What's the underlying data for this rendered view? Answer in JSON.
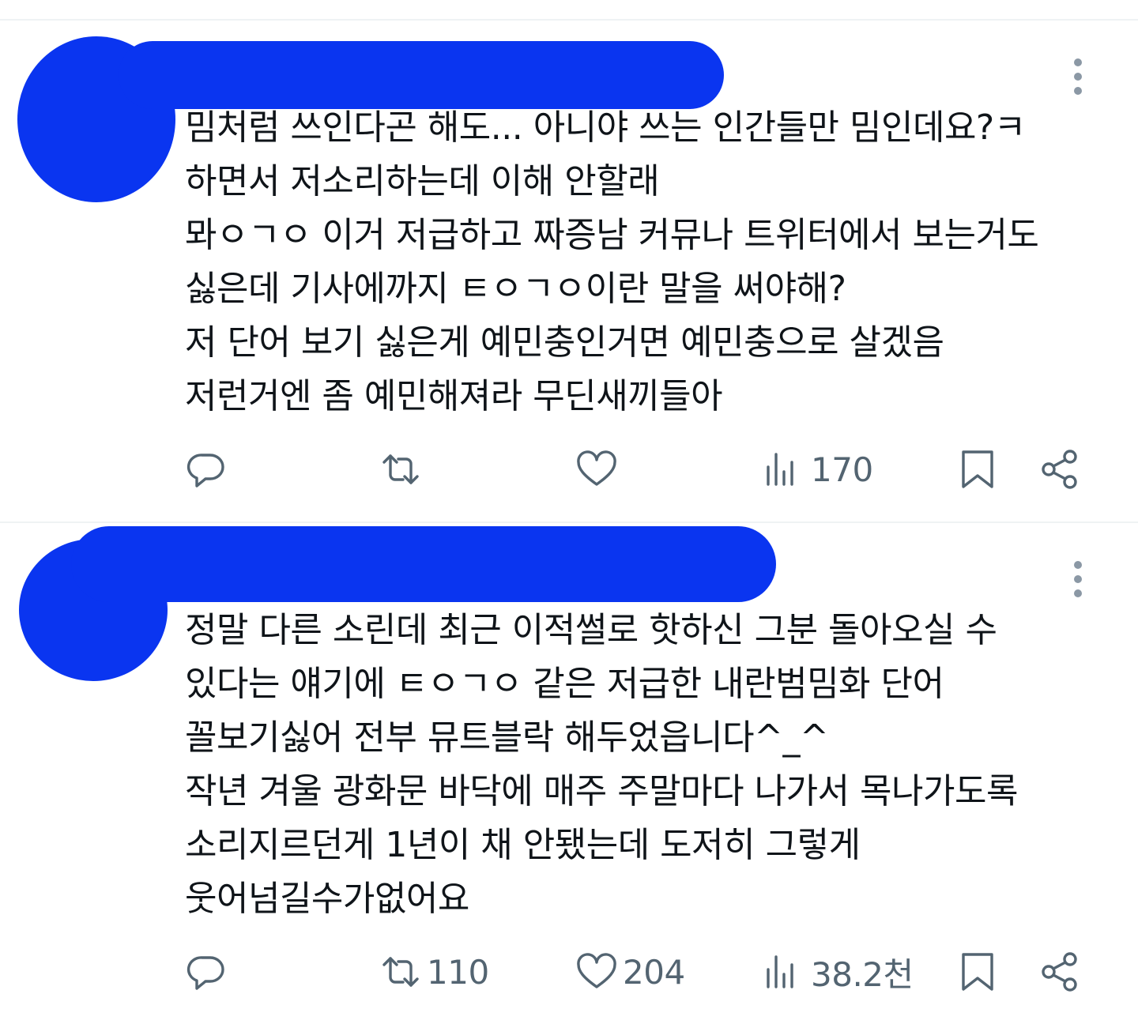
{
  "tweets": [
    {
      "lines": [
        "밈처럼 쓰인다곤 해도... 아니야 쓰는 인간들만 밈인데요?ㅋ",
        "하면서 저소리하는데 이해 안할래",
        "뫄ㅇㄱㅇ 이거 저급하고 짜증남 커뮤나 트위터에서 보는거도",
        "싫은데 기사에까지 ㅌㅇㄱㅇ이란 말을 써야해?",
        "저 단어 보기 싫은게 예민충인거면 예민충으로 살겠음",
        "저런거엔 좀 예민해져라 무딘새끼들아"
      ],
      "actions": {
        "reply_count": "",
        "retweet_count": "",
        "like_count": "",
        "views_count": "170"
      }
    },
    {
      "lines": [
        "정말 다른 소린데 최근 이적썰로 핫하신 그분 돌아오실 수",
        "있다는 얘기에 ㅌㅇㄱㅇ 같은 저급한 내란범밈화 단어",
        "꼴보기싫어 전부 뮤트블락 해두었읍니다^_^",
        "작년 겨울 광화문 바닥에 매주 주말마다 나가서 목나가도록",
        "소리지르던게 1년이 채 안됐는데 도저히 그렇게",
        "웃어넘길수가없어요"
      ],
      "actions": {
        "reply_count": "",
        "retweet_count": "110",
        "like_count": "204",
        "views_count": "38.2천"
      }
    }
  ],
  "colors": {
    "redaction": "#0a35f0",
    "highlight": "#fce07d",
    "icon": "#536471",
    "text": "#0f1419",
    "divider": "#eff3f4"
  },
  "icons": [
    "reply-icon",
    "retweet-icon",
    "like-icon",
    "views-icon",
    "bookmark-icon",
    "share-icon",
    "more-icon"
  ]
}
